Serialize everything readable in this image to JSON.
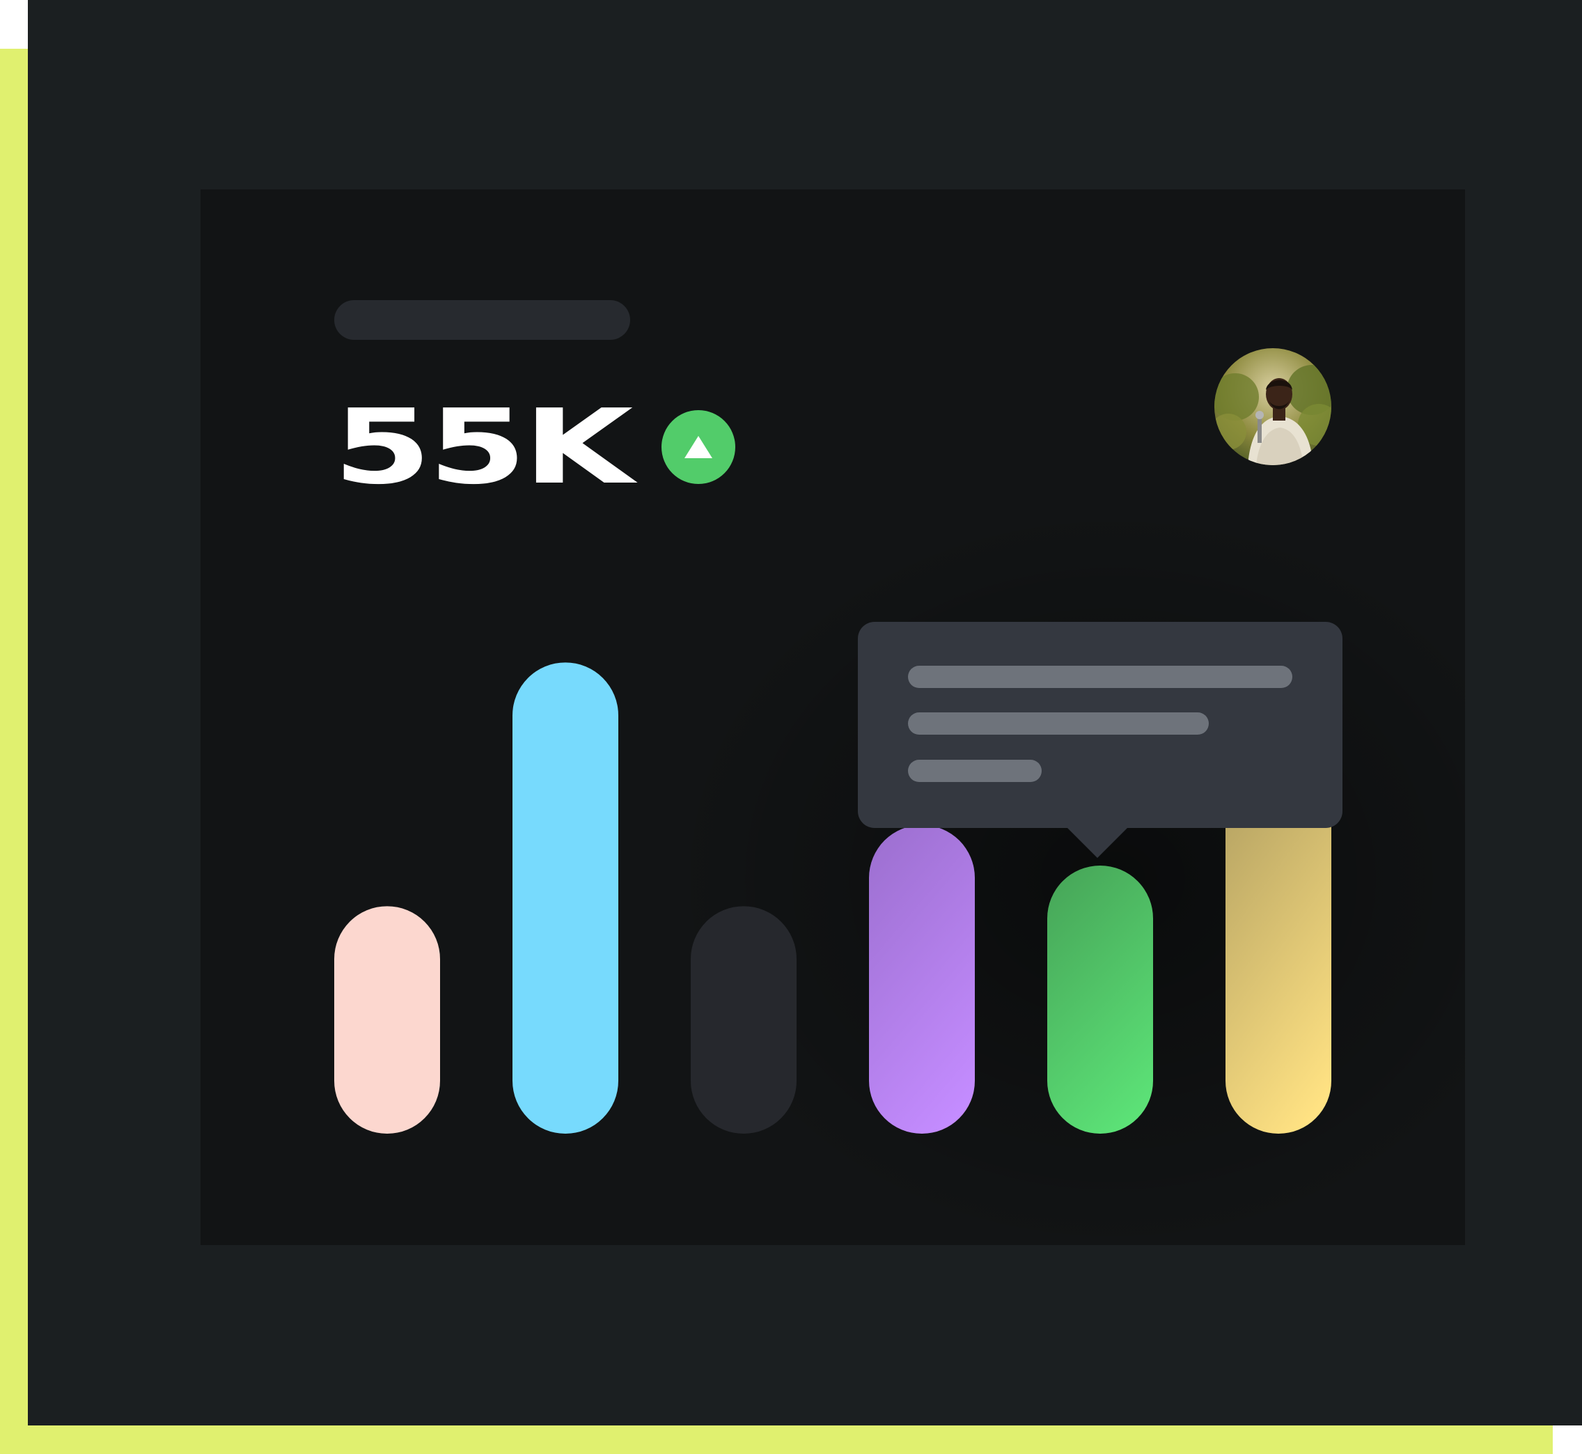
{
  "metric": {
    "value": "55K",
    "trend": "up",
    "trend_color": "#52cc6a"
  },
  "colors": {
    "accent_frame": "#e0f06f",
    "outer_panel": "#1b1f21",
    "card": "#121415",
    "placeholder": "#272a2f",
    "tooltip": "#343840",
    "tooltip_lines": "#6e737b"
  },
  "avatar": {
    "icon": "user-photo-avatar"
  },
  "chart_data": {
    "type": "bar",
    "categories": [
      "",
      "",
      "",
      "",
      "",
      ""
    ],
    "values": [
      28,
      58,
      28,
      38,
      33,
      45
    ],
    "ylim": [
      0,
      60
    ],
    "grid": false,
    "bar_colors": [
      [
        "#fcd7cf",
        "#fcd7cf"
      ],
      [
        "#77dafd",
        "#77dafd"
      ],
      [
        "#26282d",
        "#26282d"
      ],
      [
        "#9f71d3",
        "#c48cff"
      ],
      [
        "#48a95a",
        "#5ce277"
      ],
      [
        "#b8a564",
        "#ffe283"
      ]
    ],
    "highlighted_index": 4
  }
}
